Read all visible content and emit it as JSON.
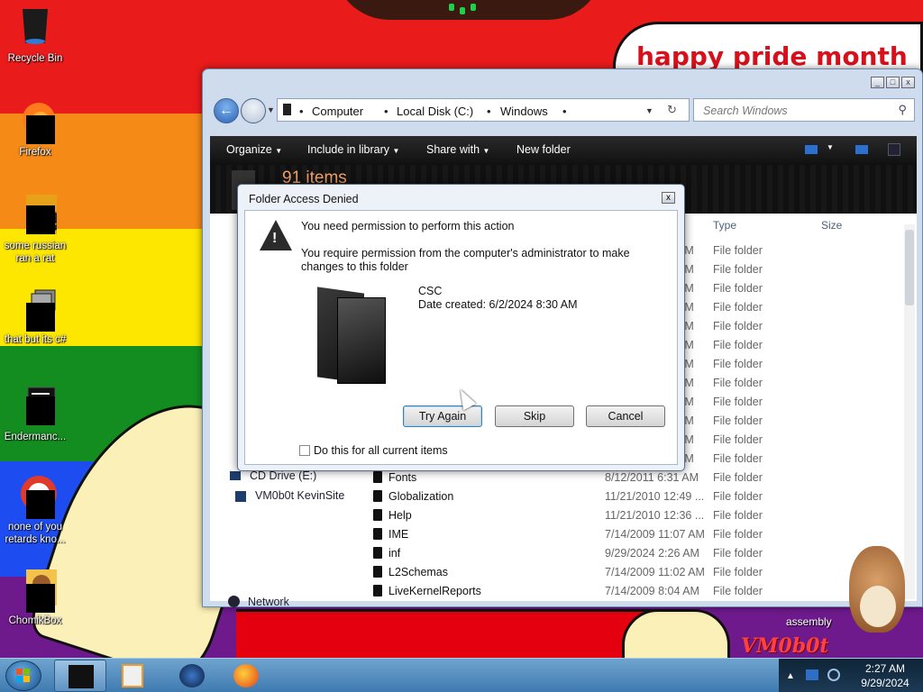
{
  "desktop": {
    "banner": "happy pride month",
    "icons": [
      {
        "label": "Recycle Bin"
      },
      {
        "label": "Firefox"
      },
      {
        "label": "some russian ran a rat"
      },
      {
        "label": "that but its c#"
      },
      {
        "label": "Endermanc..."
      },
      {
        "label": "none of you retards kno..."
      },
      {
        "label": "ChomikBox"
      }
    ],
    "overlay_text": "assembly",
    "logo_text": "VM0b0t"
  },
  "explorer": {
    "breadcrumb": [
      "Computer",
      "Local Disk (C:)",
      "Windows"
    ],
    "search_placeholder": "Search Windows",
    "toolbar": {
      "organize": "Organize",
      "include": "Include in library",
      "share": "Share with",
      "new_folder": "New folder"
    },
    "item_count": "91 items",
    "columns": {
      "type": "Type",
      "size": "Size"
    },
    "nav_pane": [
      {
        "label": "CD Drive (E:)"
      },
      {
        "label": "VM0b0t KevinSite"
      },
      {
        "label": "Network"
      }
    ],
    "upper_types": [
      "File folder",
      "File folder",
      "File folder",
      "File folder",
      "File folder",
      "File folder",
      "File folder",
      "File folder",
      "File folder",
      "File folder",
      "File folder",
      "File folder"
    ],
    "upper_dates": [
      "AM",
      "AM",
      "AM",
      "AM",
      "AM",
      "AM",
      "AM",
      "AM",
      "AM",
      "AM",
      "AM",
      "AM"
    ],
    "rows": [
      {
        "name": "Fonts",
        "date": "8/12/2011 6:31 AM",
        "type": "File folder"
      },
      {
        "name": "Globalization",
        "date": "11/21/2010 12:49 ...",
        "type": "File folder"
      },
      {
        "name": "Help",
        "date": "11/21/2010 12:36 ...",
        "type": "File folder"
      },
      {
        "name": "IME",
        "date": "7/14/2009 11:07 AM",
        "type": "File folder"
      },
      {
        "name": "inf",
        "date": "9/29/2024 2:26 AM",
        "type": "File folder"
      },
      {
        "name": "L2Schemas",
        "date": "7/14/2009 11:02 AM",
        "type": "File folder"
      },
      {
        "name": "LiveKernelReports",
        "date": "7/14/2009 8:04 AM",
        "type": "File folder"
      }
    ]
  },
  "dialog": {
    "title": "Folder Access Denied",
    "heading": "You need permission to perform this action",
    "detail": "You require permission from the computer's administrator to make changes to this folder",
    "folder_name": "CSC",
    "date_created": "Date created: 6/2/2024 8:30 AM",
    "buttons": {
      "retry": "Try Again",
      "skip": "Skip",
      "cancel": "Cancel"
    },
    "checkbox_label": "Do this for all current items",
    "checkbox_checked": false
  },
  "taskbar": {
    "time": "2:27 AM",
    "date": "9/29/2024"
  },
  "colors": {
    "accent": "#3f7ab0",
    "banner_text": "#d8101c"
  }
}
